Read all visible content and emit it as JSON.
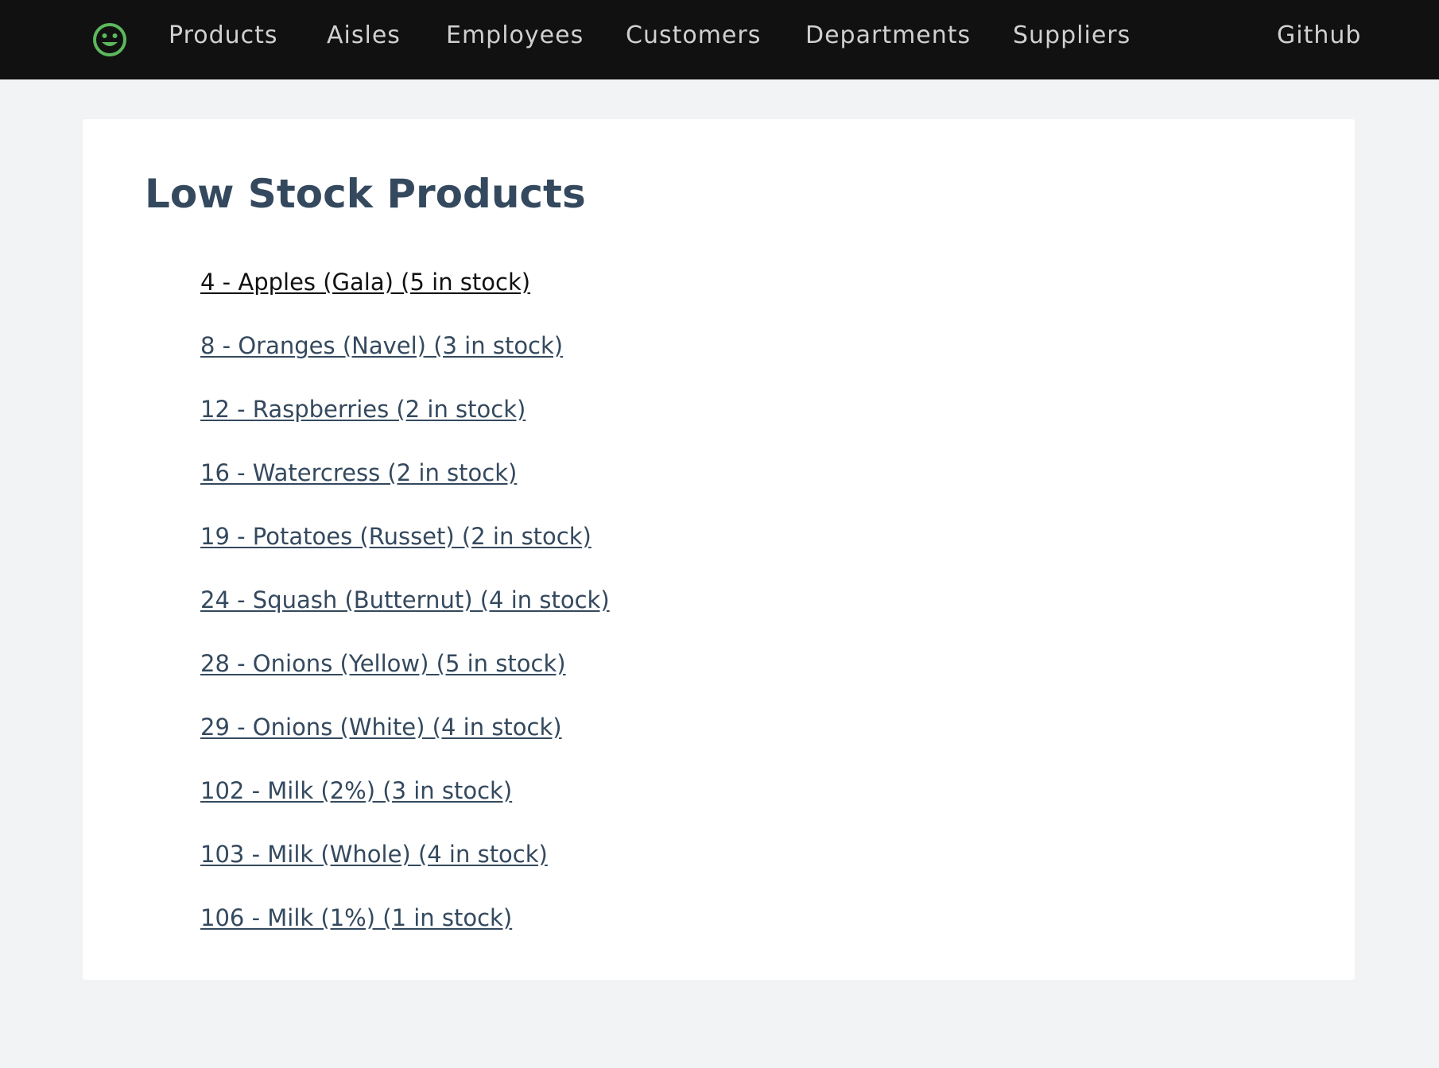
{
  "colors": {
    "navbar_bg": "#111111",
    "logo_accent": "#5cb85c",
    "page_bg": "#f2f3f5",
    "heading_text": "#34495e",
    "link_text": "#34495e",
    "hovered_link_text": "#111111"
  },
  "navbar": {
    "logo_icon": "smiley-face-icon",
    "links": [
      {
        "label": "Products"
      },
      {
        "label": "Aisles"
      },
      {
        "label": "Employees"
      },
      {
        "label": "Customers"
      },
      {
        "label": "Departments"
      },
      {
        "label": "Suppliers"
      }
    ],
    "github_label": "Github"
  },
  "main": {
    "title": "Low Stock Products",
    "products": [
      {
        "label": "4 - Apples (Gala) (5 in stock)"
      },
      {
        "label": "8 - Oranges (Navel) (3 in stock)"
      },
      {
        "label": "12 - Raspberries (2 in stock)"
      },
      {
        "label": "16 - Watercress (2 in stock)"
      },
      {
        "label": "19 - Potatoes (Russet) (2 in stock)"
      },
      {
        "label": "24 - Squash (Butternut) (4 in stock)"
      },
      {
        "label": "28 - Onions (Yellow) (5 in stock)"
      },
      {
        "label": "29 - Onions (White) (4 in stock)"
      },
      {
        "label": "102 - Milk (2%) (3 in stock)"
      },
      {
        "label": "103 - Milk (Whole) (4 in stock)"
      },
      {
        "label": "106 - Milk (1%) (1 in stock)"
      }
    ]
  }
}
